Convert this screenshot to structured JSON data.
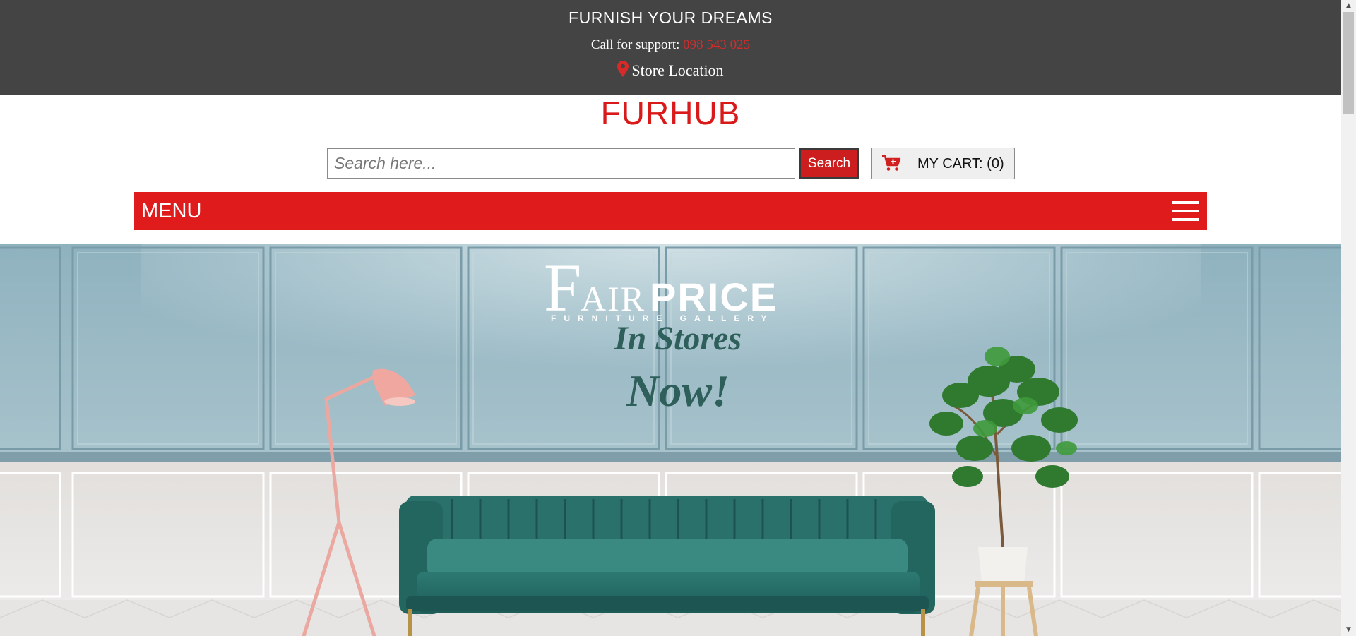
{
  "topbar": {
    "tagline": "FURNISH YOUR DREAMS",
    "support_label": "Call for support: ",
    "support_phone": "098 543 025",
    "location_label": "Store Location",
    "background_color": "#444444",
    "accent_color": "#d92a2a",
    "location_icon": "map-pin-icon"
  },
  "header": {
    "logo": "FURHUB",
    "logo_color": "#d91a1a"
  },
  "search": {
    "placeholder": "Search here...",
    "value": "",
    "button_label": "Search"
  },
  "cart": {
    "label": "MY CART: (0)",
    "icon": "shopping-cart-icon"
  },
  "menu": {
    "label": "MENU",
    "background_color": "#e01b1b",
    "toggle_icon": "hamburger-icon"
  },
  "banner": {
    "brand_title": "FAIR PRICE",
    "brand_subtitle": "FURNITURE GALLERY",
    "headline_line1": "In Stores",
    "headline_line2": "Now!"
  }
}
